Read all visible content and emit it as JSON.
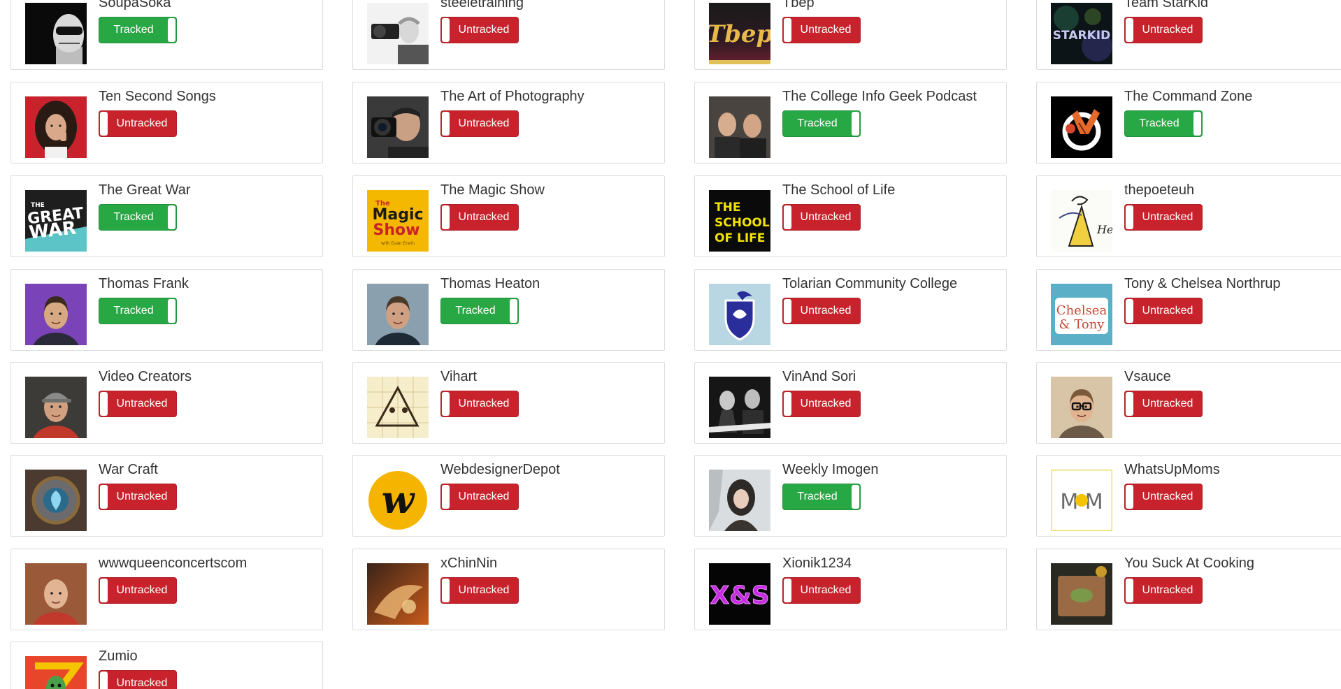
{
  "accent_colors": {
    "tracked": "#28a745",
    "untracked": "#c8232c"
  },
  "channels": [
    {
      "name": "SoupaSoka",
      "status": "Tracked",
      "icon": "masked-face-avatar-icon"
    },
    {
      "name": "steeletraining",
      "status": "Untracked",
      "icon": "photographer-avatar-icon"
    },
    {
      "name": "Tbep",
      "status": "Untracked",
      "icon": "tbep-logo-icon"
    },
    {
      "name": "Team StarKid",
      "status": "Untracked",
      "icon": "starkid-logo-icon"
    },
    {
      "name": "Ten Second Songs",
      "status": "Untracked",
      "icon": "long-haired-man-avatar-icon"
    },
    {
      "name": "The Art of Photography",
      "status": "Untracked",
      "icon": "camera-man-avatar-icon"
    },
    {
      "name": "The College Info Geek Podcast",
      "status": "Tracked",
      "icon": "two-hosts-avatar-icon"
    },
    {
      "name": "The Command Zone",
      "status": "Tracked",
      "icon": "command-zone-logo-icon"
    },
    {
      "name": "The Great War",
      "status": "Tracked",
      "icon": "great-war-logo-icon"
    },
    {
      "name": "The Magic Show",
      "status": "Untracked",
      "icon": "magic-show-logo-icon"
    },
    {
      "name": "The School of Life",
      "status": "Untracked",
      "icon": "school-of-life-logo-icon"
    },
    {
      "name": "thepoeteuh",
      "status": "Untracked",
      "icon": "sketch-drawing-avatar-icon"
    },
    {
      "name": "Thomas Frank",
      "status": "Tracked",
      "icon": "smiling-man-avatar-icon"
    },
    {
      "name": "Thomas Heaton",
      "status": "Tracked",
      "icon": "outdoor-man-avatar-icon"
    },
    {
      "name": "Tolarian Community College",
      "status": "Untracked",
      "icon": "shield-crest-logo-icon"
    },
    {
      "name": "Tony & Chelsea Northrup",
      "status": "Untracked",
      "icon": "chelsea-tony-logo-icon"
    },
    {
      "name": "Video Creators",
      "status": "Untracked",
      "icon": "cap-man-avatar-icon"
    },
    {
      "name": "Vihart",
      "status": "Untracked",
      "icon": "doodle-avatar-icon"
    },
    {
      "name": "VinAnd Sori",
      "status": "Untracked",
      "icon": "musicians-avatar-icon"
    },
    {
      "name": "Vsauce",
      "status": "Untracked",
      "icon": "glasses-man-avatar-icon"
    },
    {
      "name": "War Craft",
      "status": "Untracked",
      "icon": "hearthstone-emblem-icon"
    },
    {
      "name": "WebdesignerDepot",
      "status": "Untracked",
      "icon": "w-circle-logo-icon"
    },
    {
      "name": "Weekly Imogen",
      "status": "Tracked",
      "icon": "snowy-portrait-avatar-icon"
    },
    {
      "name": "WhatsUpMoms",
      "status": "Untracked",
      "icon": "mom-logo-icon"
    },
    {
      "name": "wwwqueenconcertscom",
      "status": "Untracked",
      "icon": "bald-man-avatar-icon"
    },
    {
      "name": "xChinNin",
      "status": "Untracked",
      "icon": "fantasy-art-avatar-icon"
    },
    {
      "name": "Xionik1234",
      "status": "Untracked",
      "icon": "xs-neon-logo-icon"
    },
    {
      "name": "You Suck At Cooking",
      "status": "Untracked",
      "icon": "cutting-board-avatar-icon"
    },
    {
      "name": "Zumio",
      "status": "Untracked",
      "icon": "zumio-logo-icon"
    }
  ]
}
